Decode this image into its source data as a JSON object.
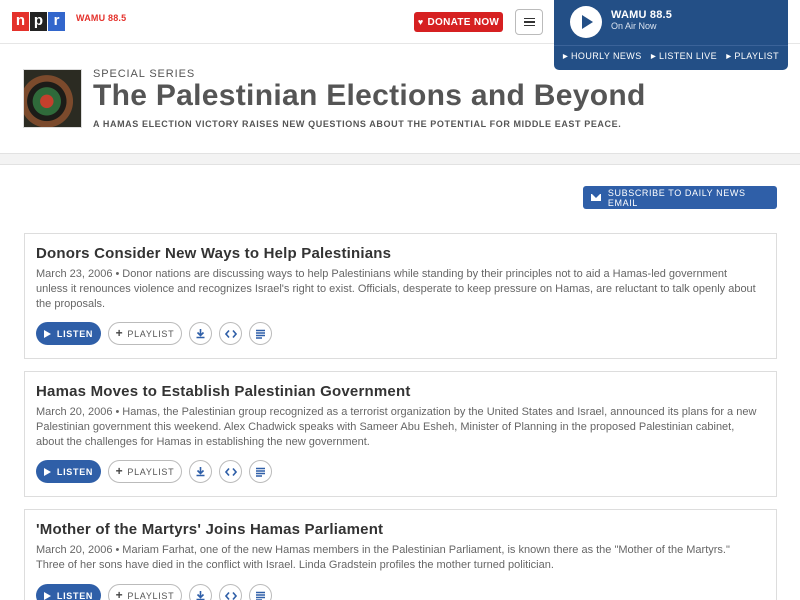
{
  "header": {
    "logo": [
      "n",
      "p",
      "r"
    ],
    "station_logo": "WAMU 88.5",
    "donate_label": "DONATE NOW",
    "menu_icon": "hamburger-icon"
  },
  "player": {
    "station": "WAMU 88.5",
    "status": "On Air Now",
    "links": [
      "HOURLY NEWS",
      "LISTEN LIVE",
      "PLAYLIST"
    ]
  },
  "series": {
    "label": "SPECIAL SERIES",
    "title": "The Palestinian Elections and Beyond",
    "description": "A HAMAS ELECTION VICTORY RAISES NEW QUESTIONS ABOUT THE POTENTIAL FOR MIDDLE EAST PEACE."
  },
  "subscribe_label": "SUBSCRIBE TO DAILY NEWS EMAIL",
  "actions": {
    "listen": "LISTEN",
    "playlist": "PLAYLIST"
  },
  "stories": [
    {
      "title": "Donors Consider New Ways to Help Palestinians",
      "date": "March 23, 2006",
      "teaser": "Donor nations are discussing ways to help Palestinians while standing by their principles not to aid a Hamas-led government unless it renounces violence and recognizes Israel's right to exist. Officials, desperate to keep pressure on Hamas, are reluctant to talk openly about the proposals."
    },
    {
      "title": "Hamas Moves to Establish Palestinian Government",
      "date": "March 20, 2006",
      "teaser": "Hamas, the Palestinian group recognized as a terrorist organization by the United States and Israel, announced its plans for a new Palestinian government this weekend. Alex Chadwick speaks with Sameer Abu Esheh, Minister of Planning in the proposed Palestinian cabinet, about the challenges for Hamas in establishing the new government."
    },
    {
      "title": "'Mother of the Martyrs' Joins Hamas Parliament",
      "date": "March 20, 2006",
      "teaser": "Mariam Farhat, one of the new Hamas members in the Palestinian Parliament, is known there as the \"Mother of the Martyrs.\" Three of her sons have died in the conflict with Israel. Linda Gradstein profiles the mother turned politician."
    }
  ],
  "colors": {
    "brand_blue": "#2f5fa8",
    "player_blue": "#234f86",
    "donate_red": "#d62021"
  }
}
